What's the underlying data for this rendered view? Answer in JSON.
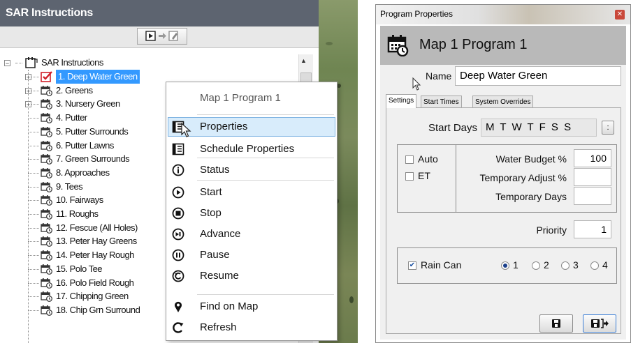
{
  "left_panel": {
    "title": "SAR Instructions",
    "tree_root": "SAR Instructions",
    "tree_items": [
      {
        "label": "1. Deep Water Green"
      },
      {
        "label": "2. Greens"
      },
      {
        "label": "3. Nursery Green"
      },
      {
        "label": "4. Putter"
      },
      {
        "label": "5. Putter Surrounds"
      },
      {
        "label": "6. Putter Lawns"
      },
      {
        "label": "7. Green Surrounds"
      },
      {
        "label": "8. Approaches"
      },
      {
        "label": "9. Tees"
      },
      {
        "label": "10. Fairways"
      },
      {
        "label": "11. Roughs"
      },
      {
        "label": "12. Fescue (All Holes)"
      },
      {
        "label": "13. Peter Hay Greens"
      },
      {
        "label": "14. Peter Hay Rough"
      },
      {
        "label": "15. Polo Tee"
      },
      {
        "label": "16. Polo Field Rough"
      },
      {
        "label": "17. Chipping Green"
      },
      {
        "label": "18. Chip Grn Surround"
      }
    ]
  },
  "context_menu": {
    "header": "Map 1 Program 1",
    "items": [
      {
        "label": "Properties",
        "icon": "properties-icon"
      },
      {
        "label": "Schedule Properties",
        "icon": "schedule-properties-icon"
      },
      {
        "label": "Status",
        "icon": "info-icon"
      },
      {
        "label": "Start",
        "icon": "play-icon"
      },
      {
        "label": "Stop",
        "icon": "stop-icon"
      },
      {
        "label": "Advance",
        "icon": "advance-icon"
      },
      {
        "label": "Pause",
        "icon": "pause-icon"
      },
      {
        "label": "Resume",
        "icon": "resume-icon"
      },
      {
        "label": "Find on Map",
        "icon": "map-pin-icon"
      },
      {
        "label": "Refresh",
        "icon": "refresh-icon"
      }
    ]
  },
  "dialog": {
    "window_title": "Program Properties",
    "header_title": "Map 1 Program 1",
    "name_label": "Name",
    "name_value": "Deep Water Green",
    "tabs": [
      "Settings",
      "Start Times",
      "System Overrides"
    ],
    "start_days_label": "Start Days",
    "start_days_value": "M T W T F S S",
    "start_days_button": ":",
    "auto_label": "Auto",
    "et_label": "ET",
    "water_budget_label": "Water Budget %",
    "water_budget_value": "100",
    "temp_adjust_label": "Temporary Adjust %",
    "temp_adjust_value": "",
    "temp_days_label": "Temporary Days",
    "temp_days_value": "",
    "priority_label": "Priority",
    "priority_value": "1",
    "rain_can_label": "Rain Can",
    "rain_can_checked": true,
    "rain_can_options": [
      "1",
      "2",
      "3",
      "4"
    ],
    "rain_can_selected": "1"
  },
  "colors": {
    "header_bg": "#5d6470",
    "selection": "#3399ff",
    "menu_highlight": "#d8ecfb"
  }
}
